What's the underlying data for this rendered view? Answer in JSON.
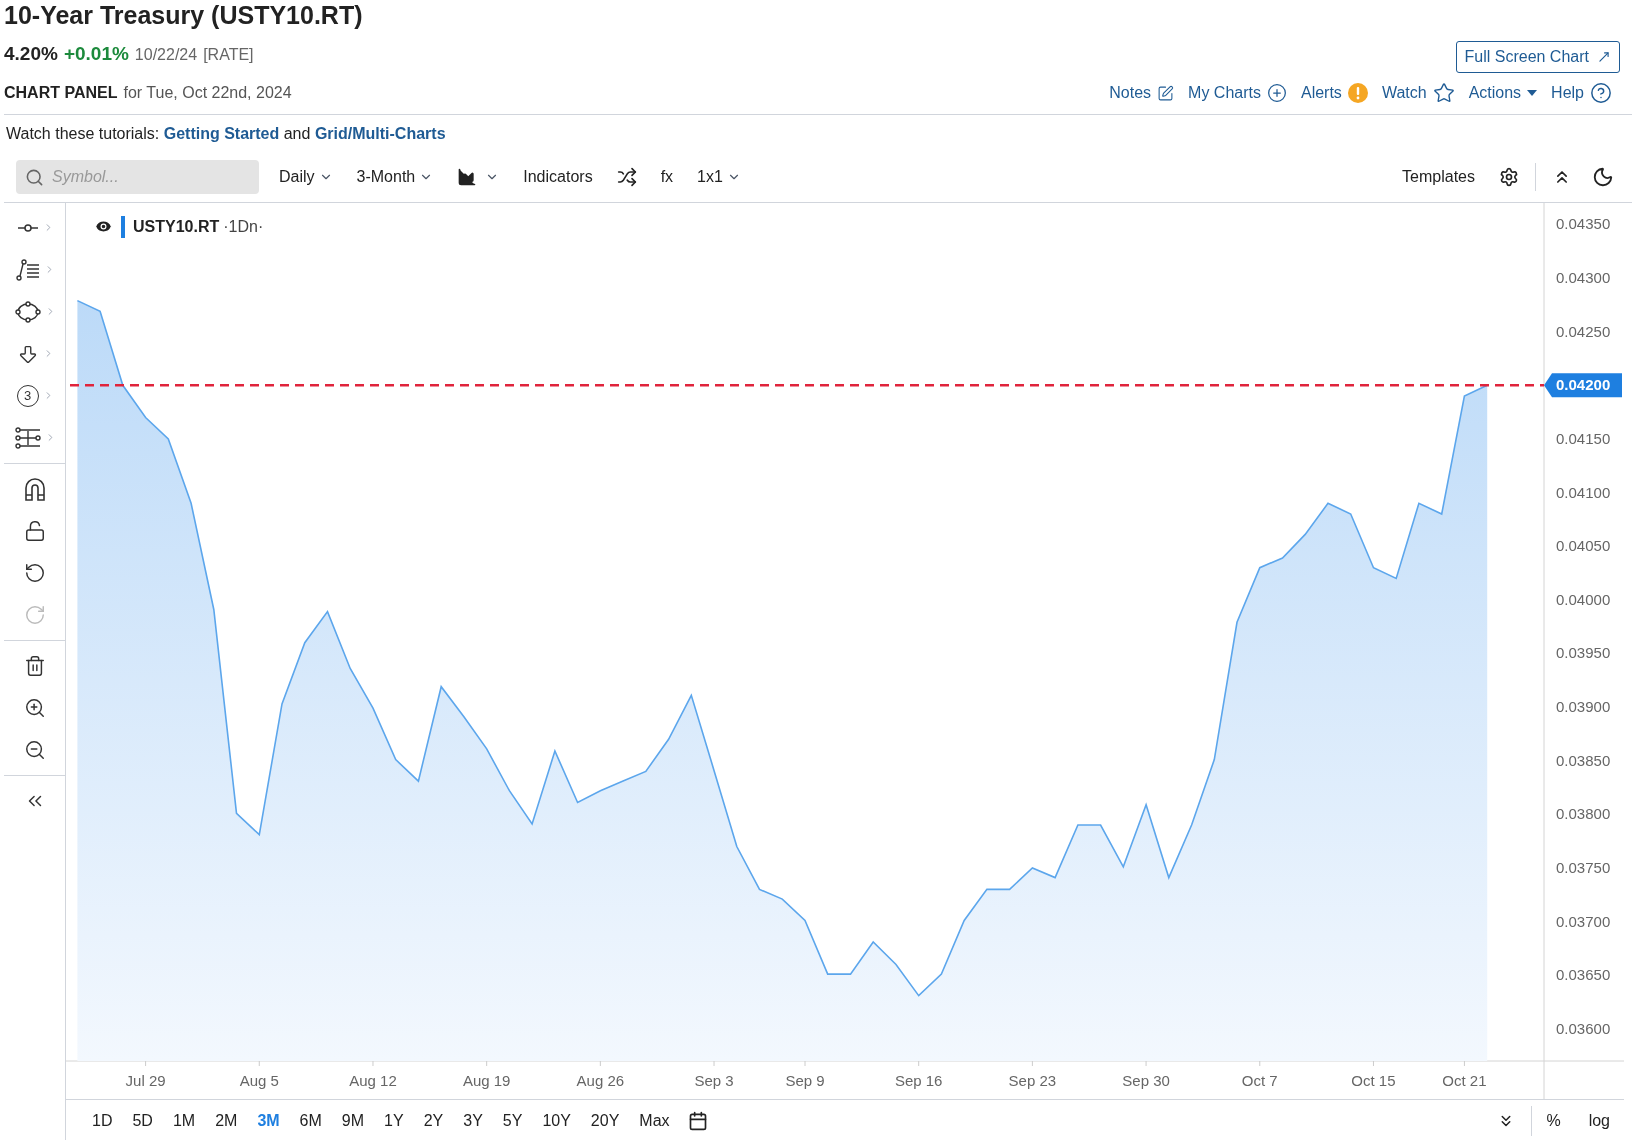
{
  "header": {
    "title": "10-Year Treasury (USTY10.RT)",
    "price": "4.20%",
    "change": "+0.01%",
    "date": "10/22/24",
    "tag": "[RATE]",
    "full_screen_button": "Full Screen Chart"
  },
  "panel": {
    "title": "CHART PANEL",
    "subtitle": "for Tue, Oct 22nd, 2024"
  },
  "panel_links": [
    {
      "label": "Notes",
      "kind": "notes"
    },
    {
      "label": "My Charts",
      "kind": "add"
    },
    {
      "label": "Alerts",
      "kind": "alert"
    },
    {
      "label": "Watch",
      "kind": "star"
    },
    {
      "label": "Actions",
      "kind": "menu"
    },
    {
      "label": "Help",
      "kind": "help"
    }
  ],
  "tutorials": {
    "prefix": "Watch these tutorials:",
    "link_1": "Getting Started",
    "joiner": "and",
    "link_2": "Grid/Multi-Charts"
  },
  "toolbar": {
    "search": {
      "placeholder": "Symbol..."
    },
    "left_items": [
      {
        "kind": "dropdown",
        "label": "Daily"
      },
      {
        "kind": "dropdown",
        "label": "3-Month"
      },
      {
        "kind": "chart-type"
      },
      {
        "kind": "text",
        "label": "Indicators"
      },
      {
        "kind": "shuffle"
      },
      {
        "kind": "text",
        "label": "fx"
      },
      {
        "kind": "dropdown",
        "label": "1x1"
      }
    ],
    "templates": "Templates"
  },
  "side_tools": {
    "number_tool": "3",
    "history": [
      {
        "disabled": false
      },
      {
        "disabled": true
      }
    ]
  },
  "legend": {
    "interval": "·1Dn·",
    "color": "#1e7fe0"
  },
  "chart_data": {
    "type": "area",
    "categories": [
      null,
      null,
      null,
      "Jul 29",
      null,
      null,
      null,
      null,
      "Aug 5",
      null,
      null,
      null,
      null,
      "Aug 12",
      null,
      null,
      null,
      null,
      "Aug 19",
      null,
      null,
      null,
      null,
      "Aug 26",
      null,
      null,
      null,
      null,
      "Sep 3",
      null,
      null,
      null,
      "Sep 9",
      null,
      null,
      null,
      null,
      "Sep 16",
      null,
      null,
      null,
      null,
      "Sep 23",
      null,
      null,
      null,
      null,
      "Sep 30",
      null,
      null,
      null,
      null,
      "Oct 7",
      null,
      null,
      null,
      null,
      "Oct 15",
      null,
      null,
      null,
      "Oct 21",
      null
    ],
    "series": [
      {
        "name": "USTY10.RT",
        "color": "#5ca6ec",
        "values": [
          0.04279,
          0.04269,
          0.042,
          0.0417,
          0.0415,
          0.0409,
          0.03991,
          0.03801,
          0.03781,
          0.03903,
          0.0396,
          0.03989,
          0.03936,
          0.03899,
          0.03851,
          0.03831,
          0.03919,
          0.03891,
          0.03861,
          0.03822,
          0.03791,
          0.03859,
          0.03811,
          0.03822,
          0.03831,
          0.0384,
          0.0387,
          0.03911,
          0.03841,
          0.0377,
          0.0373,
          0.03721,
          0.03701,
          0.03651,
          0.03651,
          0.03681,
          0.0366,
          0.03631,
          0.03651,
          0.03701,
          0.0373,
          0.0373,
          0.0375,
          0.03741,
          0.0379,
          0.0379,
          0.03751,
          0.03809,
          0.03741,
          0.0379,
          0.03851,
          0.03979,
          0.0403,
          0.04039,
          0.04061,
          0.0409,
          0.0408,
          0.0403,
          0.0402,
          0.0409,
          0.0408,
          0.0419,
          0.042
        ]
      }
    ],
    "ylim": [
      0.0357,
      0.0437
    ],
    "yticks": [
      {
        "value": 0.0435,
        "label": "0.04350"
      },
      {
        "value": 0.043,
        "label": "0.04300"
      },
      {
        "value": 0.0425,
        "label": "0.04250"
      },
      {
        "value": 0.0415,
        "label": "0.04150"
      },
      {
        "value": 0.041,
        "label": "0.04100"
      },
      {
        "value": 0.0405,
        "label": "0.04050"
      },
      {
        "value": 0.04,
        "label": "0.04000"
      },
      {
        "value": 0.0395,
        "label": "0.03950"
      },
      {
        "value": 0.039,
        "label": "0.03900"
      },
      {
        "value": 0.0385,
        "label": "0.03850"
      },
      {
        "value": 0.038,
        "label": "0.03800"
      },
      {
        "value": 0.0375,
        "label": "0.03750"
      },
      {
        "value": 0.037,
        "label": "0.03700"
      },
      {
        "value": 0.0365,
        "label": "0.03650"
      },
      {
        "value": 0.036,
        "label": "0.03600"
      }
    ],
    "ref_lines": [
      {
        "axis": "y",
        "value": 0.042,
        "label": "0.04200",
        "color": "#e0243c"
      }
    ]
  },
  "ranges": [
    {
      "label": "1D",
      "selected": false
    },
    {
      "label": "5D",
      "selected": false
    },
    {
      "label": "1M",
      "selected": false
    },
    {
      "label": "2M",
      "selected": false
    },
    {
      "label": "3M",
      "selected": true
    },
    {
      "label": "6M",
      "selected": false
    },
    {
      "label": "9M",
      "selected": false
    },
    {
      "label": "1Y",
      "selected": false
    },
    {
      "label": "2Y",
      "selected": false
    },
    {
      "label": "3Y",
      "selected": false
    },
    {
      "label": "5Y",
      "selected": false
    },
    {
      "label": "10Y",
      "selected": false
    },
    {
      "label": "20Y",
      "selected": false
    },
    {
      "label": "Max",
      "selected": false
    }
  ],
  "scale_options": [
    "%",
    "log"
  ]
}
